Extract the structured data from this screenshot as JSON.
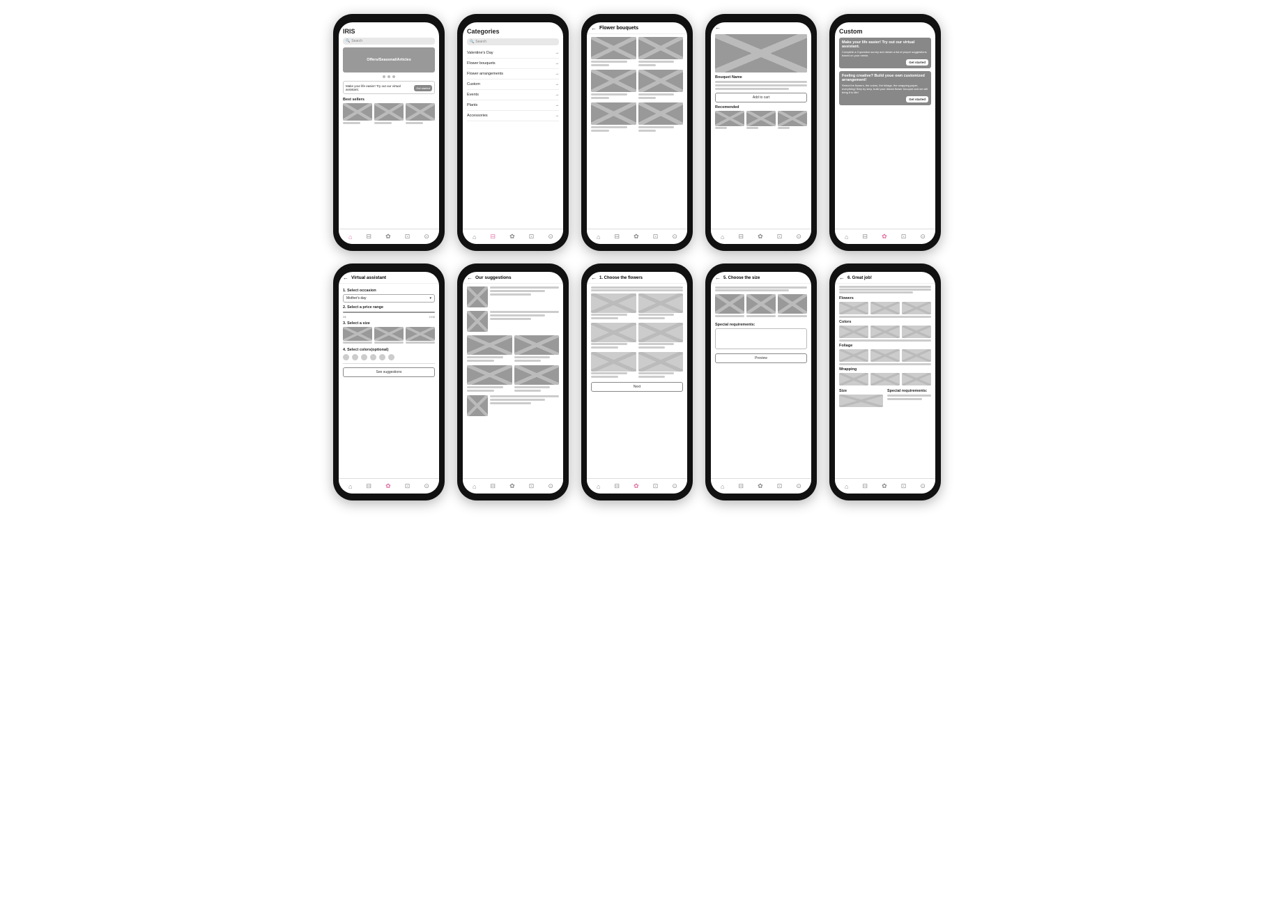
{
  "phones": [
    {
      "id": "home",
      "title": "IRIS",
      "activeNav": 0,
      "type": "home"
    },
    {
      "id": "categories",
      "title": "Categories",
      "activeNav": 1,
      "type": "categories"
    },
    {
      "id": "flower-bouquets",
      "title": "Flower bouquets",
      "hasBack": true,
      "activeNav": 2,
      "type": "flower-bouquets"
    },
    {
      "id": "product-detail",
      "title": "",
      "hasBack": true,
      "activeNav": -1,
      "type": "product-detail"
    },
    {
      "id": "custom",
      "title": "Custom",
      "hasBack": false,
      "activeNav": 4,
      "type": "custom"
    },
    {
      "id": "virtual-assistant",
      "title": "Virtual assistant",
      "hasBack": true,
      "activeNav": 4,
      "type": "virtual-assistant"
    },
    {
      "id": "our-suggestions",
      "title": "Our suggestions",
      "hasBack": true,
      "activeNav": -1,
      "type": "our-suggestions"
    },
    {
      "id": "choose-flowers",
      "title": "1. Choose the flowers",
      "hasBack": true,
      "activeNav": 4,
      "type": "choose-flowers"
    },
    {
      "id": "choose-size",
      "title": "5. Choose the size",
      "hasBack": true,
      "activeNav": -1,
      "type": "choose-size"
    },
    {
      "id": "great-job",
      "title": "6. Great job!",
      "hasBack": true,
      "activeNav": -1,
      "type": "great-job"
    }
  ],
  "labels": {
    "search": "Search",
    "home_app_name": "IRIS",
    "banner_text": "Offers/Seasonal/Articles",
    "best_sellers": "Best sellers",
    "promo_title": "Make your life easier! Try out our virtual assistant.",
    "get_started": "Get started",
    "categories_title": "Categories",
    "cat_items": [
      {
        "label": "Valentine's Day",
        "arrow": "→"
      },
      {
        "label": "Flower bouquets",
        "arrow": "→"
      },
      {
        "label": "Flower arrangements",
        "arrow": "→"
      },
      {
        "label": "Custom",
        "arrow": "→"
      },
      {
        "label": "Events",
        "arrow": "→"
      },
      {
        "label": "Plants",
        "arrow": "→"
      },
      {
        "label": "Accessories",
        "arrow": "→"
      }
    ],
    "bouquet_name": "Bouquet Name",
    "add_to_cart": "Add to cart",
    "recommended": "Recomended",
    "custom_title": "Custom",
    "custom_card1_title": "Make your life easier! Try out our virtual assistant.",
    "custom_card1_desc": "Complete a 3 question survey and obtain a list of proper suggestions based on your needs",
    "custom_card2_title": "Feeling creative? Build youe own customized arrangement!",
    "custom_card2_desc": "Select the flowers, the colors, the foliage, the wrapping paper, everything! Step by step, build your dream flower bouquet and we will bring it to life!",
    "va_title": "Virtual assistant",
    "va_step1": "1. Select occasion",
    "va_step1_value": "Mother's day",
    "va_step2": "2. Select a price range",
    "va_price_min": "0$",
    "va_price_max": "100$",
    "va_step3": "3. Select a size",
    "va_step4": "4. Select colors(optional)",
    "see_suggestions": "See suggestions",
    "suggestions_title": "Our suggestions",
    "choose_flowers_title": "1. Choose the flowers",
    "next": "Next",
    "choose_size_title": "5. Choose the size",
    "special_req": "Special requirements:",
    "preview": "Preview",
    "great_job_title": "6. Great job!",
    "flowers_label": "Flowers",
    "colors_label": "Colors",
    "foliage_label": "Foliage",
    "wrapping_label": "Wrapping",
    "size_label": "Size",
    "special_req2": "Special requirements:"
  }
}
